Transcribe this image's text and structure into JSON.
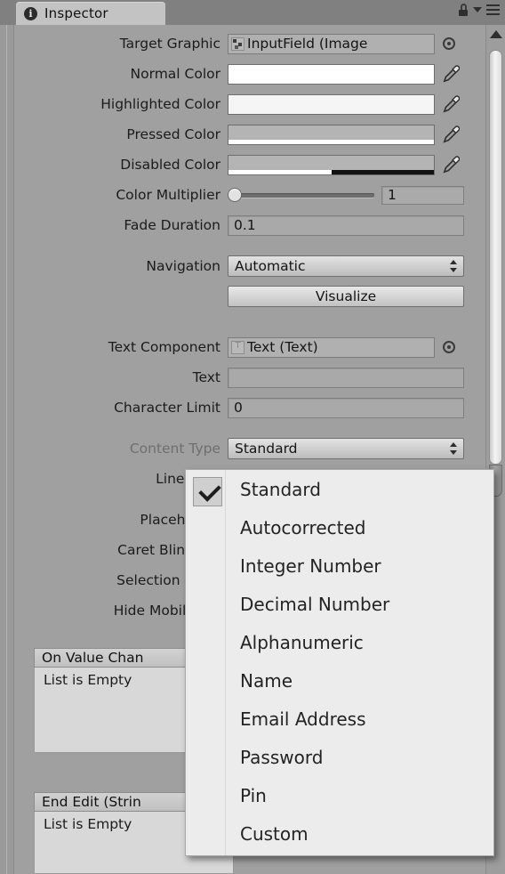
{
  "window": {
    "tab_label": "Inspector",
    "tab_icon": "info-circle-icon",
    "lock_icon": "lock-icon",
    "caret_icon": "chevron-down-icon",
    "menu_icon": "hamburger-menu-icon"
  },
  "rows": {
    "target_graphic": {
      "label": "Target Graphic",
      "value": "InputField (Image"
    },
    "normal_color": {
      "label": "Normal Color",
      "color": "#ffffff",
      "alpha": 100
    },
    "highlighted_color": {
      "label": "Highlighted Color",
      "color": "#f5f5f5",
      "alpha": 100
    },
    "pressed_color": {
      "label": "Pressed Color",
      "color": "#b4b4b4",
      "alpha": 100
    },
    "disabled_color": {
      "label": "Disabled Color",
      "color": "#b4b4b4",
      "alpha": 50
    },
    "color_multiplier": {
      "label": "Color Multiplier",
      "value": "1",
      "slider_pct": 0
    },
    "fade_duration": {
      "label": "Fade Duration",
      "value": "0.1"
    },
    "navigation": {
      "label": "Navigation",
      "value": "Automatic"
    },
    "visualize": {
      "label": "Visualize"
    },
    "text_component": {
      "label": "Text Component",
      "value": "Text (Text)"
    },
    "text": {
      "label": "Text",
      "value": ""
    },
    "character_limit": {
      "label": "Character Limit",
      "value": "0"
    },
    "content_type": {
      "label": "Content Type",
      "value": "Standard"
    },
    "line_type": {
      "label": "Line Type"
    },
    "placeholder": {
      "label": "Placeholder"
    },
    "caret_blink_rate": {
      "label": "Caret Blink Rat"
    },
    "selection_color": {
      "label": "Selection Color"
    },
    "hide_mobile_input": {
      "label": "Hide Mobile Inp"
    }
  },
  "events": {
    "on_value_changed": {
      "header": "On Value Chan",
      "empty_text": "List is Empty"
    },
    "end_edit": {
      "header": "End Edit (Strin",
      "empty_text": "List is Empty"
    }
  },
  "dropdown": {
    "selected": "Standard",
    "items": [
      "Standard",
      "Autocorrected",
      "Integer Number",
      "Decimal Number",
      "Alphanumeric",
      "Name",
      "Email Address",
      "Password",
      "Pin",
      "Custom"
    ]
  },
  "colors": {
    "panel_bg": "#a0a0a0",
    "chrome_bg": "#808080",
    "popup_bg": "#ececec",
    "text": "#1b1b1b"
  }
}
